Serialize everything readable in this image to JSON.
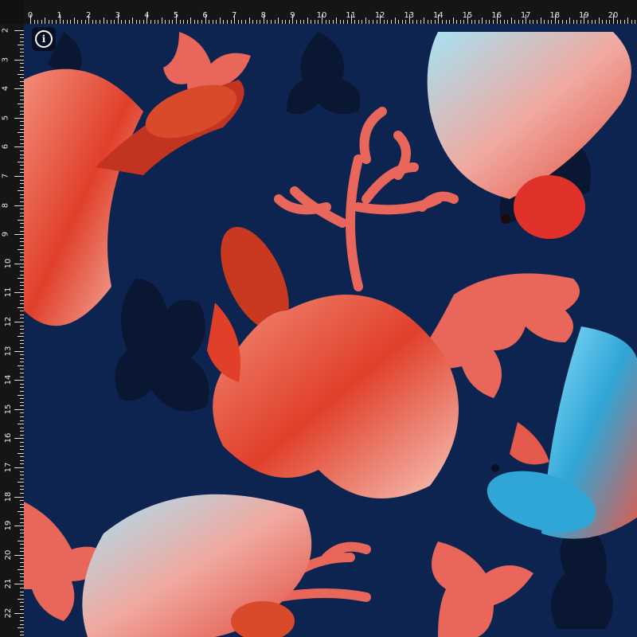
{
  "ruler": {
    "unit_labels_top": [
      "0",
      "1",
      "2",
      "3",
      "4",
      "5",
      "6",
      "7",
      "8",
      "9",
      "10",
      "11",
      "12",
      "13",
      "14",
      "15",
      "16",
      "17",
      "18",
      "19",
      "20"
    ],
    "unit_labels_left": [
      "2",
      "3",
      "4",
      "5",
      "6",
      "7",
      "8",
      "9",
      "10",
      "11",
      "12",
      "13",
      "14",
      "15",
      "16",
      "17",
      "18",
      "19",
      "20",
      "21",
      "22"
    ]
  },
  "info_button": {
    "icon": "info-icon",
    "glyph": "i"
  },
  "artwork": {
    "background_color": "#0e2450",
    "coral_color": "#e8665a",
    "dark_coral_color": "#0a1733",
    "fish_red": "#e0402a",
    "fish_blue": "#2fa6d6",
    "fin_pale": "#f6b3a8"
  }
}
